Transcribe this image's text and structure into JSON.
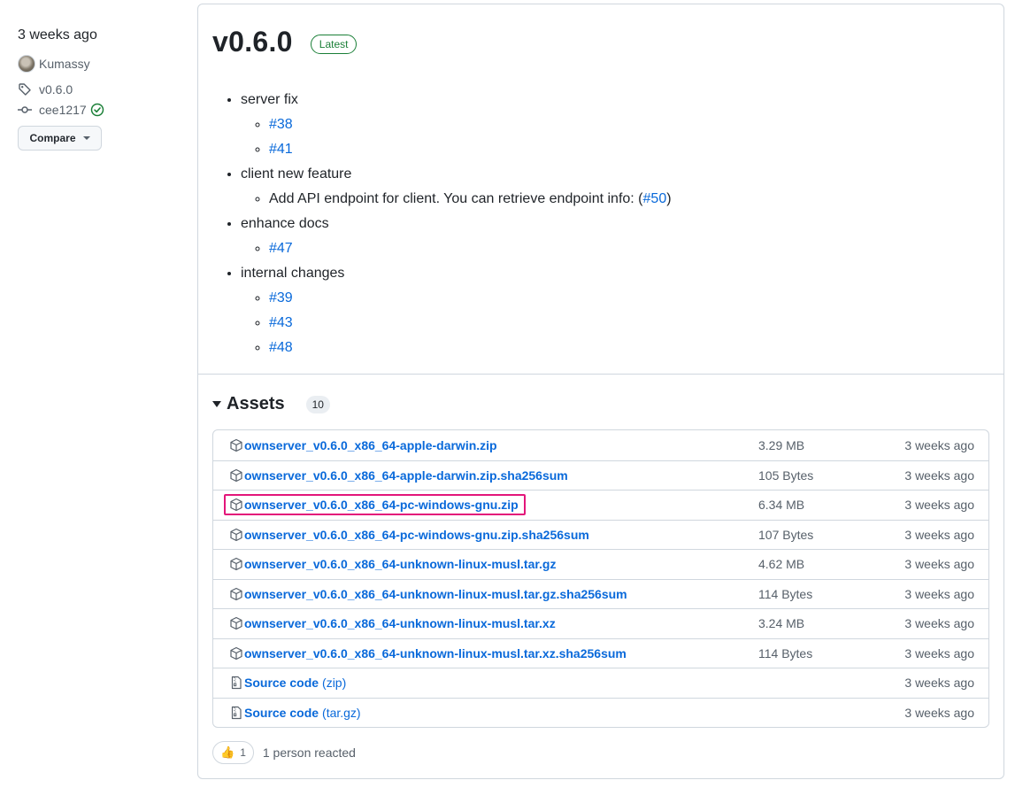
{
  "sidebar": {
    "date": "3 weeks ago",
    "author": "Kumassy",
    "tag": "v0.6.0",
    "commit": "cee1217",
    "compare_label": "Compare"
  },
  "release": {
    "version": "v0.6.0",
    "badge": "Latest",
    "notes": [
      {
        "text": "server fix",
        "sub": [
          "#38",
          "#41"
        ]
      },
      {
        "text": "client new feature",
        "sub_text": "Add API endpoint for client. You can retrieve endpoint info: (",
        "sub_link": "#50",
        "sub_after": ")"
      },
      {
        "text": "enhance docs",
        "sub": [
          "#47"
        ]
      },
      {
        "text": "internal changes",
        "sub": [
          "#39",
          "#43",
          "#48"
        ]
      }
    ]
  },
  "assets": {
    "title": "Assets",
    "count": "10",
    "rows": [
      {
        "name": "ownserver_v0.6.0_x86_64-apple-darwin.zip",
        "size": "3.29 MB",
        "date": "3 weeks ago"
      },
      {
        "name": "ownserver_v0.6.0_x86_64-apple-darwin.zip.sha256sum",
        "size": "105 Bytes",
        "date": "3 weeks ago"
      },
      {
        "name": "ownserver_v0.6.0_x86_64-pc-windows-gnu.zip",
        "size": "6.34 MB",
        "date": "3 weeks ago",
        "highlighted": true
      },
      {
        "name": "ownserver_v0.6.0_x86_64-pc-windows-gnu.zip.sha256sum",
        "size": "107 Bytes",
        "date": "3 weeks ago"
      },
      {
        "name": "ownserver_v0.6.0_x86_64-unknown-linux-musl.tar.gz",
        "size": "4.62 MB",
        "date": "3 weeks ago"
      },
      {
        "name": "ownserver_v0.6.0_x86_64-unknown-linux-musl.tar.gz.sha256sum",
        "size": "114 Bytes",
        "date": "3 weeks ago"
      },
      {
        "name": "ownserver_v0.6.0_x86_64-unknown-linux-musl.tar.xz",
        "size": "3.24 MB",
        "date": "3 weeks ago"
      },
      {
        "name": "ownserver_v0.6.0_x86_64-unknown-linux-musl.tar.xz.sha256sum",
        "size": "114 Bytes",
        "date": "3 weeks ago"
      }
    ],
    "source_rows": [
      {
        "name": "Source code",
        "ext": "(zip)",
        "date": "3 weeks ago"
      },
      {
        "name": "Source code",
        "ext": "(tar.gz)",
        "date": "3 weeks ago"
      }
    ]
  },
  "reactions": {
    "emoji": "👍",
    "count": "1",
    "text": "1 person reacted"
  },
  "colors": {
    "link": "#0969da",
    "latest_badge": "#1a7f37",
    "highlight_box": "#e3167a",
    "border": "#d0d7de"
  }
}
